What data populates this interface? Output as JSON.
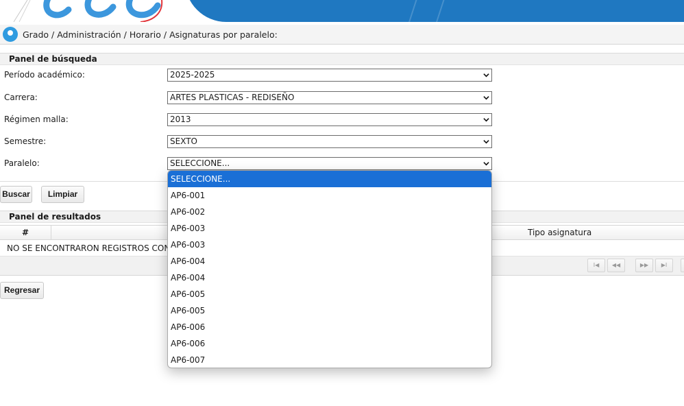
{
  "breadcrumb": {
    "path": "Grado / Administración / Horario / Asignaturas por paralelo:"
  },
  "search_panel": {
    "title": "Panel de búsqueda",
    "fields": [
      {
        "label": "Período académico:",
        "value": "2025-2025"
      },
      {
        "label": "Carrera:",
        "value": "ARTES PLASTICAS - REDISEÑO"
      },
      {
        "label": "Régimen malla:",
        "value": "2013"
      },
      {
        "label": "Semestre:",
        "value": "SEXTO"
      },
      {
        "label": "Paralelo:",
        "value": "SELECCIONE..."
      }
    ]
  },
  "buttons": {
    "search": "Buscar",
    "clear": "Limpiar",
    "back": "Regresar"
  },
  "results_panel": {
    "title": "Panel de resultados",
    "columns": {
      "number": "#",
      "type": "Tipo asignatura"
    },
    "empty_message": "NO SE ENCONTRARON REGISTROS CON LOS"
  },
  "paginator": {
    "first": "I◀",
    "prev": "◀◀",
    "next": "▶▶",
    "last": "▶I"
  },
  "paralelo_dropdown": {
    "selected_index": 0,
    "options": [
      "SELECCIONE...",
      "AP6-001",
      "AP6-002",
      "AP6-003",
      "AP6-003",
      "AP6-004",
      "AP6-004",
      "AP6-005",
      "AP6-005",
      "AP6-006",
      "AP6-006",
      "AP6-007"
    ]
  },
  "colors": {
    "accent": "#1f78c1",
    "selected_option": "#1a6fd6",
    "pin": "#2f9be0"
  },
  "icons": {
    "location": "map-pin-icon",
    "select_arrow": "chevron-down-icon"
  }
}
